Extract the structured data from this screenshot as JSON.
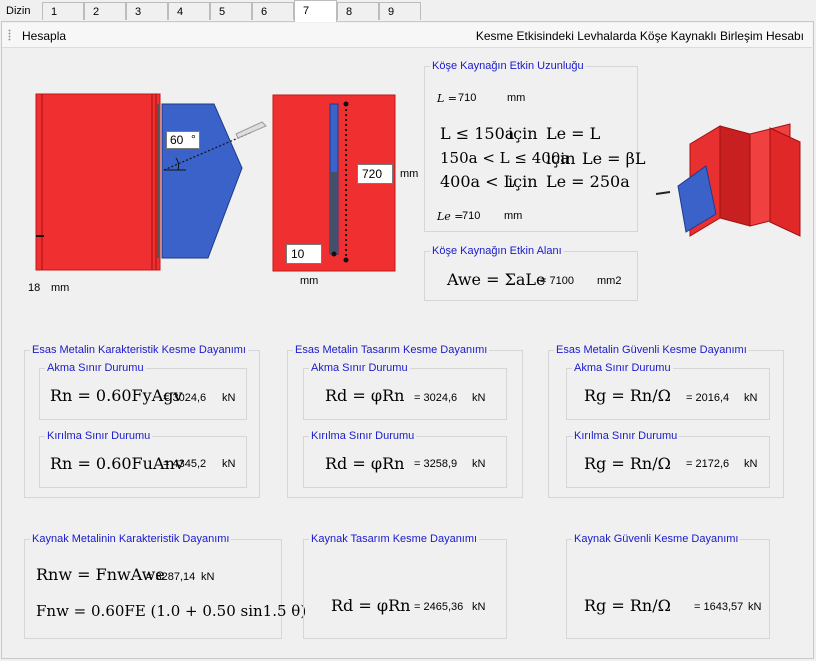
{
  "tabs": {
    "label": "Dizin",
    "items": [
      "1",
      "2",
      "3",
      "4",
      "5",
      "6",
      "7",
      "8",
      "9"
    ],
    "active": "7"
  },
  "toolbar": {
    "button": "Hesapla",
    "title": "Kesme Etkisindeki Levhalarda Köşe Kaynaklı Birleşim Hesabı"
  },
  "drawing": {
    "angle_value": "60",
    "angle_unit": "°",
    "thickness_value": "18",
    "thickness_unit": "mm",
    "length_input": "720",
    "length_unit": "mm",
    "weld_input": "10",
    "weld_unit": "mm",
    "colors": {
      "plate": "#f03030",
      "gusset": "#3a62c8",
      "weld": "#1a1a1a"
    }
  },
  "effective_length": {
    "title": "Köşe Kaynağın Etkin Uzunluğu",
    "L_label": "L =",
    "L_value": "710",
    "L_unit": "mm",
    "rows": [
      {
        "cond": "L ≤ 150a",
        "kw": "için",
        "res": "Le = L"
      },
      {
        "cond": "150a < L ≤ 400a",
        "kw": "için",
        "res": "Le = βL"
      },
      {
        "cond": "400a < L",
        "kw": "için",
        "res": "Le = 250a"
      }
    ],
    "Le_label": "Le =",
    "Le_value": "710",
    "Le_unit": "mm"
  },
  "effective_area": {
    "title": "Köşe Kaynağın Etkin Alanı",
    "formula": "Awe = ΣaLe",
    "value": "= 7100",
    "unit": "mm2"
  },
  "base_char": {
    "title": "Esas Metalin Karakteristik Kesme Dayanımı",
    "yield_title": "Akma Sınır Durumu",
    "yield_formula": "Rn = 0.60FyAgv",
    "yield_value": "= 3024,6",
    "yield_unit": "kN",
    "rupture_title": "Kırılma Sınır Durumu",
    "rupture_formula": "Rn = 0.60FuAnv",
    "rupture_value": "= 4345,2",
    "rupture_unit": "kN"
  },
  "base_design": {
    "title": "Esas Metalin Tasarım Kesme Dayanımı",
    "yield_title": "Akma Sınır Durumu",
    "yield_formula": "Rd = φRn",
    "yield_value": "= 3024,6",
    "yield_unit": "kN",
    "rupture_title": "Kırılma Sınır Durumu",
    "rupture_formula": "Rd = φRn",
    "rupture_value": "= 3258,9",
    "rupture_unit": "kN"
  },
  "base_safe": {
    "title": "Esas Metalin Güvenli Kesme Dayanımı",
    "yield_title": "Akma Sınır Durumu",
    "yield_formula": "Rg = Rn/Ω",
    "yield_value": "= 2016,4",
    "yield_unit": "kN",
    "rupture_title": "Kırılma Sınır Durumu",
    "rupture_formula": "Rg = Rn/Ω",
    "rupture_value": "= 2172,6",
    "rupture_unit": "kN"
  },
  "weld_char": {
    "title": "Kaynak Metalinin Karakteristik Dayanımı",
    "formula1": "Rnw = FnwAwe",
    "value": "= 3287,14",
    "unit": "kN",
    "formula2": "Fnw = 0.60FE (1.0 + 0.50 sin1.5 θ)"
  },
  "weld_design": {
    "title": "Kaynak Tasarım Kesme Dayanımı",
    "formula": "Rd = φRn",
    "value": "= 2465,36",
    "unit": "kN"
  },
  "weld_safe": {
    "title": "Kaynak Güvenli Kesme Dayanımı",
    "formula": "Rg = Rn/Ω",
    "value": "= 1643,57",
    "unit": "kN"
  }
}
